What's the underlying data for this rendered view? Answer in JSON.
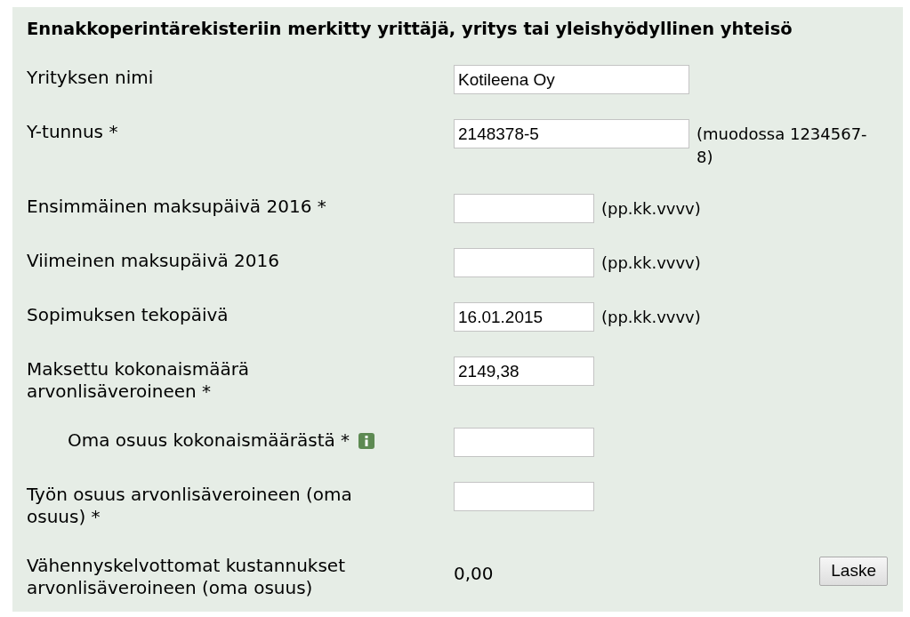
{
  "title": "Ennakkoperintärekisteriin merkitty yrittäjä, yritys tai yleishyödyllinen yhteisö",
  "fields": [
    {
      "kind": "text",
      "label": "Yrityksen nimi",
      "value": "Kotileena Oy"
    },
    {
      "kind": "text",
      "label": "Y-tunnus *",
      "value": "2148378-5",
      "hint": "(muodossa 1234567-8)"
    },
    {
      "kind": "date",
      "label": "Ensimmäinen maksupäivä 2016 *",
      "hint": "(pp.kk.vvvv)"
    },
    {
      "kind": "date",
      "label": "Viimeinen maksupäivä 2016",
      "hint": "(pp.kk.vvvv)"
    },
    {
      "kind": "date",
      "label": "Sopimuksen tekopäivä",
      "value": "16.01.2015",
      "hint": "(pp.kk.vvvv)"
    },
    {
      "kind": "amount",
      "label": "Maksettu kokonaismäärä arvonlisäveroineen *",
      "value": "2149,38",
      "children": [
        {
          "kind": "amount",
          "label": "Oma osuus kokonaismäärästä *",
          "info": true
        }
      ]
    },
    {
      "kind": "amount",
      "label": "Työn osuus arvonlisäveroineen (oma osuus) *"
    },
    {
      "kind": "result",
      "label": "Vähennyskelvottomat kustannukset arvonlisäveroineen (oma osuus)",
      "value": "0,00",
      "button": "Laske"
    }
  ]
}
